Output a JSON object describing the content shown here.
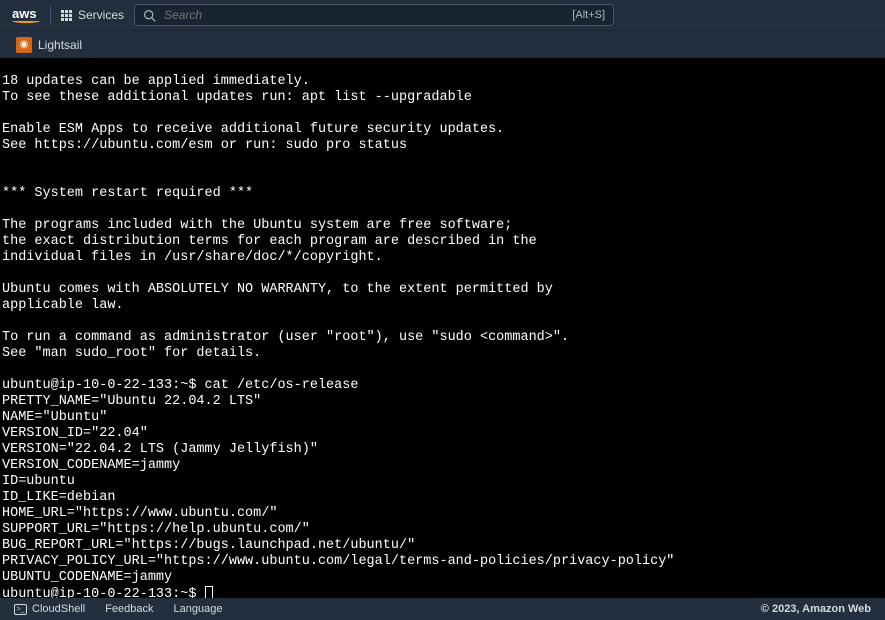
{
  "header": {
    "logo": "aws",
    "services_label": "Services",
    "search_placeholder": "Search",
    "search_shortcut": "[Alt+S]"
  },
  "subheader": {
    "service_name": "Lightsail"
  },
  "terminal": {
    "lines": [
      "",
      "18 updates can be applied immediately.",
      "To see these additional updates run: apt list --upgradable",
      "",
      "Enable ESM Apps to receive additional future security updates.",
      "See https://ubuntu.com/esm or run: sudo pro status",
      "",
      "",
      "*** System restart required ***",
      "",
      "The programs included with the Ubuntu system are free software;",
      "the exact distribution terms for each program are described in the",
      "individual files in /usr/share/doc/*/copyright.",
      "",
      "Ubuntu comes with ABSOLUTELY NO WARRANTY, to the extent permitted by",
      "applicable law.",
      "",
      "To run a command as administrator (user \"root\"), use \"sudo <command>\".",
      "See \"man sudo_root\" for details.",
      "",
      "ubuntu@ip-10-0-22-133:~$ cat /etc/os-release",
      "PRETTY_NAME=\"Ubuntu 22.04.2 LTS\"",
      "NAME=\"Ubuntu\"",
      "VERSION_ID=\"22.04\"",
      "VERSION=\"22.04.2 LTS (Jammy Jellyfish)\"",
      "VERSION_CODENAME=jammy",
      "ID=ubuntu",
      "ID_LIKE=debian",
      "HOME_URL=\"https://www.ubuntu.com/\"",
      "SUPPORT_URL=\"https://help.ubuntu.com/\"",
      "BUG_REPORT_URL=\"https://bugs.launchpad.net/ubuntu/\"",
      "PRIVACY_POLICY_URL=\"https://www.ubuntu.com/legal/terms-and-policies/privacy-policy\"",
      "UBUNTU_CODENAME=jammy"
    ],
    "prompt": "ubuntu@ip-10-0-22-133:~$ "
  },
  "footer": {
    "cloudshell": "CloudShell",
    "feedback": "Feedback",
    "language": "Language",
    "copyright": "© 2023, Amazon Web"
  }
}
